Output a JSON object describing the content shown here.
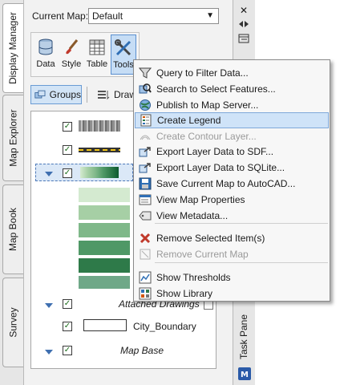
{
  "vertical_tabs": [
    "Display Manager",
    "Map Explorer",
    "Map Book",
    "Survey"
  ],
  "right_strip": {
    "task_pane_label": "Task Pane",
    "close_glyph": "✕"
  },
  "current_map": {
    "label": "Current Map:",
    "value": "Default"
  },
  "tools": [
    {
      "label": "Data",
      "icon": "database-icon"
    },
    {
      "label": "Style",
      "icon": "brush-icon"
    },
    {
      "label": "Table",
      "icon": "table-icon"
    },
    {
      "label": "Tools",
      "icon": "tools-icon"
    }
  ],
  "view_buttons": {
    "groups": "Groups",
    "draw": "Draw"
  },
  "tree": {
    "attached_drawings": "Attached Drawings",
    "city_boundary": "City_Boundary",
    "map_base": "Map Base"
  },
  "swatch_colors": [
    "#d4ead0",
    "#a6cfa5",
    "#7fb889",
    "#4f9866",
    "#2e7a49",
    "#0d5a2e",
    "#6fa888"
  ],
  "menu": {
    "items": [
      {
        "label": "Query to Filter Data...",
        "icon": "funnel-icon",
        "state": "normal"
      },
      {
        "label": "Search to Select Features...",
        "icon": "search-select-icon",
        "state": "normal"
      },
      {
        "label": "Publish to Map Server...",
        "icon": "globe-icon",
        "state": "normal"
      },
      {
        "label": "Create Legend",
        "icon": "legend-icon",
        "state": "highlighted"
      },
      {
        "label": "Create Contour Layer...",
        "icon": "contour-icon",
        "state": "disabled"
      },
      {
        "label": "Export Layer Data to SDF...",
        "icon": "export-icon",
        "state": "normal"
      },
      {
        "label": "Export Layer Data to SQLite...",
        "icon": "export-sqlite-icon",
        "state": "normal"
      },
      {
        "label": "Save Current Map to AutoCAD...",
        "icon": "save-icon",
        "state": "normal"
      },
      {
        "label": "View Map Properties",
        "icon": "properties-icon",
        "state": "normal"
      },
      {
        "label": "View Metadata...",
        "icon": "metadata-icon",
        "state": "normal"
      },
      {
        "label": "Remove Selected Item(s)",
        "icon": "remove-icon",
        "state": "normal"
      },
      {
        "label": "Remove Current Map",
        "icon": "remove-map-icon",
        "state": "disabled"
      },
      {
        "label": "Show Thresholds",
        "icon": "thresholds-icon",
        "state": "normal"
      },
      {
        "label": "Show Library",
        "icon": "library-icon",
        "state": "normal"
      }
    ]
  }
}
